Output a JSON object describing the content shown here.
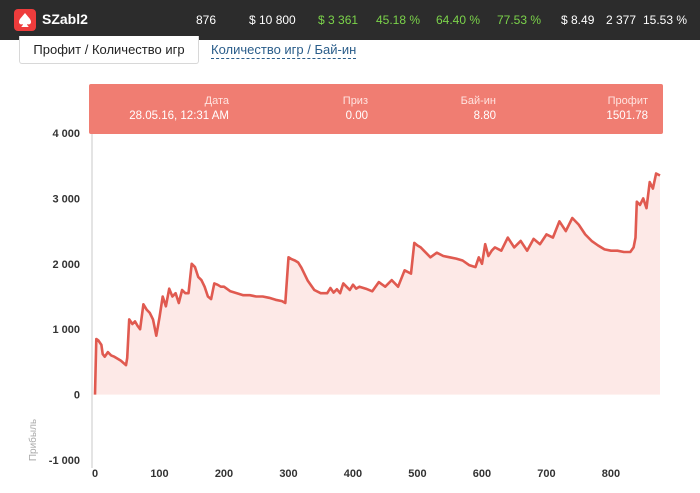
{
  "header": {
    "player": "SZabl2",
    "stats": [
      {
        "text": "876",
        "color": "white"
      },
      {
        "text": "$ 10 800",
        "color": "white"
      },
      {
        "text": "$ 3 361",
        "color": "green"
      },
      {
        "text": "45.18 %",
        "color": "green"
      },
      {
        "text": "64.40 %",
        "color": "green"
      },
      {
        "text": "77.53 %",
        "color": "green"
      },
      {
        "text": "$ 8.49",
        "color": "white"
      },
      {
        "text": "2 377",
        "color": "white"
      },
      {
        "text": "15.53 %",
        "color": "white"
      }
    ]
  },
  "tabs": {
    "active": "Профит / Количество игр",
    "other": "Количество игр / Бай-ин"
  },
  "tooltip": {
    "date_label": "Дата",
    "date_value": "28.05.16, 12:31 AM",
    "prize_label": "Приз",
    "prize_value": "0.00",
    "buyin_label": "Бай-ин",
    "buyin_value": "8.80",
    "profit_label": "Профит",
    "profit_value": "1501.78"
  },
  "colors": {
    "accent": "#f07d72",
    "line": "#e05a50",
    "area": "#fde9e7",
    "header_bg": "#2c2c2c",
    "positive": "#7bd34a"
  },
  "chart_data": {
    "type": "area",
    "title": "",
    "xlabel": "",
    "ylabel": "Прибыль",
    "xlim": [
      0,
      876
    ],
    "ylim": [
      -1000,
      4000
    ],
    "xticks": [
      "0",
      "100",
      "200",
      "300",
      "400",
      "500",
      "600",
      "700",
      "800"
    ],
    "yticks": [
      "-1 000",
      "0",
      "1 000",
      "2 000",
      "3 000",
      "4 000"
    ],
    "grid": false,
    "series": [
      {
        "name": "",
        "x": [
          0,
          2,
          5,
          10,
          12,
          15,
          20,
          25,
          30,
          40,
          48,
          50,
          53,
          58,
          62,
          66,
          70,
          75,
          80,
          85,
          90,
          95,
          100,
          105,
          110,
          115,
          120,
          125,
          130,
          135,
          140,
          145,
          150,
          155,
          160,
          165,
          170,
          175,
          180,
          185,
          190,
          195,
          200,
          210,
          220,
          230,
          240,
          250,
          260,
          270,
          280,
          290,
          295,
          300,
          305,
          310,
          315,
          320,
          330,
          340,
          350,
          360,
          365,
          370,
          375,
          380,
          385,
          390,
          395,
          400,
          405,
          410,
          420,
          430,
          440,
          450,
          460,
          470,
          480,
          490,
          495,
          500,
          505,
          510,
          520,
          530,
          540,
          550,
          560,
          570,
          580,
          590,
          595,
          600,
          605,
          610,
          615,
          620,
          630,
          640,
          650,
          660,
          670,
          680,
          690,
          700,
          710,
          720,
          730,
          740,
          750,
          760,
          770,
          780,
          790,
          800,
          810,
          820,
          830,
          835,
          838,
          840,
          845,
          850,
          855,
          860,
          865,
          870,
          876
        ],
        "values": [
          0,
          850,
          830,
          760,
          620,
          580,
          650,
          600,
          580,
          520,
          450,
          560,
          1150,
          1080,
          1120,
          1050,
          1000,
          1380,
          1300,
          1250,
          1150,
          900,
          1180,
          1500,
          1350,
          1620,
          1500,
          1550,
          1400,
          1600,
          1550,
          1550,
          2000,
          1950,
          1800,
          1750,
          1650,
          1500,
          1460,
          1700,
          1680,
          1650,
          1650,
          1580,
          1550,
          1520,
          1520,
          1500,
          1500,
          1480,
          1450,
          1430,
          1400,
          2100,
          2070,
          2050,
          2020,
          1940,
          1740,
          1600,
          1550,
          1550,
          1630,
          1560,
          1610,
          1550,
          1700,
          1650,
          1600,
          1680,
          1620,
          1650,
          1620,
          1580,
          1720,
          1650,
          1750,
          1650,
          1900,
          1850,
          2320,
          2280,
          2250,
          2200,
          2100,
          2170,
          2120,
          2100,
          2080,
          2050,
          1980,
          1950,
          2100,
          2000,
          2300,
          2120,
          2200,
          2250,
          2200,
          2400,
          2250,
          2350,
          2200,
          2380,
          2300,
          2450,
          2400,
          2650,
          2500,
          2700,
          2600,
          2450,
          2350,
          2280,
          2220,
          2200,
          2200,
          2180,
          2180,
          2250,
          2400,
          2950,
          2900,
          3000,
          2850,
          3250,
          3150,
          3380,
          3350
        ]
      }
    ]
  }
}
